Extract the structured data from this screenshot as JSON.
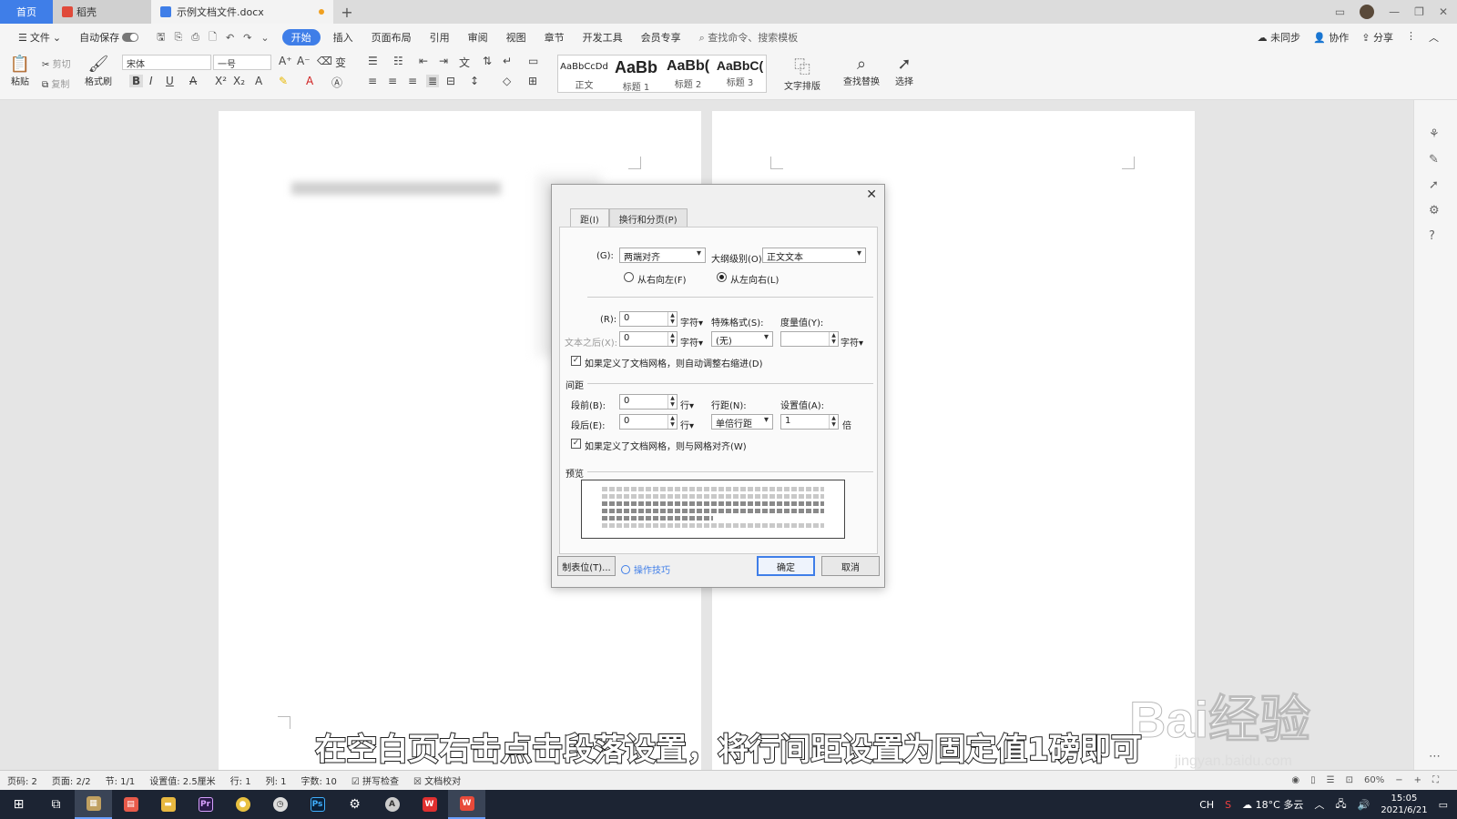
{
  "titlebar": {
    "tabs": [
      {
        "label": "首页"
      },
      {
        "label": "稻壳"
      },
      {
        "label": "示例文档文件.docx"
      }
    ],
    "add_label": "+"
  },
  "menubar": {
    "file": "文件",
    "autosave": "自动保存",
    "items": [
      "开始",
      "插入",
      "页面布局",
      "引用",
      "审阅",
      "视图",
      "章节",
      "开发工具",
      "会员专享"
    ],
    "search_placeholder": "查找命令、搜索模板",
    "right": [
      "未同步",
      "协作",
      "分享"
    ]
  },
  "ribbon": {
    "paste": "粘贴",
    "cut": "剪切",
    "copy": "复制",
    "format_painter": "格式刷",
    "font_name": "宋体",
    "font_size": "一号",
    "styles": [
      {
        "sample": "AaBbCcDd",
        "label": "正文"
      },
      {
        "sample": "AaBb",
        "label": "标题 1"
      },
      {
        "sample": "AaBb(",
        "label": "标题 2"
      },
      {
        "sample": "AaBbC(",
        "label": "标题 3"
      }
    ],
    "text_layout": "文字排版",
    "find_replace": "查找替换",
    "select": "选择"
  },
  "dialog": {
    "tab_indent": "缩进和间距(I)",
    "tab_indent_visible": "距(I)",
    "tab_breaks": "换行和分页(P)",
    "align_label": "(G):",
    "align_value": "两端对齐",
    "outline_label": "大纲级别(O):",
    "outline_value": "正文文本",
    "rtl_label": "从右向左(F)",
    "ltr_label": "从左向右(L)",
    "indent_before_label": "(R):",
    "indent_before_value": "0",
    "indent_after_label": "文本之后(X):",
    "indent_after_value": "0",
    "unit_char": "字符▾",
    "special_label": "特殊格式(S):",
    "special_value": "(无)",
    "measure_label": "度量值(Y):",
    "measure_value": "",
    "auto_indent_label": "如果定义了文档网格，则自动调整右缩进(D)",
    "spacing_section": "间距",
    "before_label": "段前(B):",
    "before_value": "0",
    "after_label": "段后(E):",
    "after_value": "0",
    "unit_line": "行▾",
    "line_spacing_label": "行距(N):",
    "line_spacing_value": "单倍行距",
    "setting_label": "设置值(A):",
    "setting_value": "1",
    "unit_times": "倍",
    "grid_align_label": "如果定义了文档网格，则与网格对齐(W)",
    "preview_section": "预览",
    "tabs_button": "制表位(T)...",
    "tips_link": "操作技巧",
    "ok_button": "确定",
    "cancel_button": "取消"
  },
  "subtitle": "在空白页右击点击段落设置，将行间距设置为固定值1磅即可",
  "watermark": {
    "text": "Bai经验",
    "url": "jingyan.baidu.com"
  },
  "statusbar": {
    "items": [
      "页码: 2",
      "页面: 2/2",
      "节: 1/1",
      "设置值: 2.5厘米",
      "行: 1",
      "列: 1",
      "字数: 10",
      "拼写检查",
      "文档校对"
    ],
    "zoom": "60%"
  },
  "taskbar": {
    "weather": "18°C 多云",
    "ime": "CH",
    "time": "15:05",
    "date": "2021/6/21"
  }
}
